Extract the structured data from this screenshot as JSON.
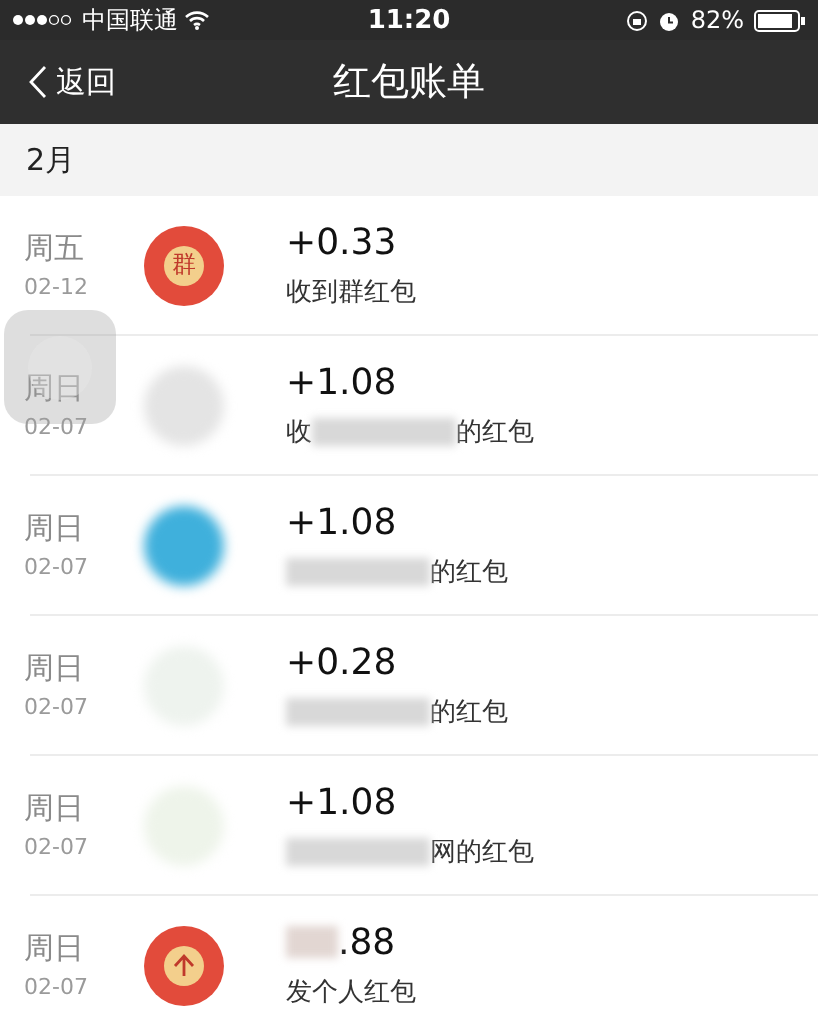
{
  "status_bar": {
    "carrier": "中国联通",
    "time": "11:20",
    "battery": "82%"
  },
  "nav": {
    "back": "返回",
    "title": "红包账单"
  },
  "section": "2月",
  "records": [
    {
      "weekday": "周五",
      "date": "02-12",
      "icon": {
        "kind": "group",
        "glyph": "群"
      },
      "amount": "+0.33",
      "amount_blurred": false,
      "description_blurred": false,
      "description": "收到群红包"
    },
    {
      "weekday": "周日",
      "date": "02-07",
      "icon": {
        "kind": "blurred",
        "color": "#e4e4e4"
      },
      "amount": "+1.08",
      "amount_blurred": false,
      "description_lead": "收",
      "description_blurred": true,
      "description": "的红包"
    },
    {
      "weekday": "周日",
      "date": "02-07",
      "icon": {
        "kind": "blurred",
        "color": "#3fb0dc"
      },
      "amount": "+1.08",
      "amount_blurred": false,
      "description_blurred": true,
      "description": "的红包"
    },
    {
      "weekday": "周日",
      "date": "02-07",
      "icon": {
        "kind": "blurred",
        "color": "#eef3ee"
      },
      "amount": "+0.28",
      "amount_blurred": false,
      "description_blurred": true,
      "description": "的红包"
    },
    {
      "weekday": "周日",
      "date": "02-07",
      "icon": {
        "kind": "blurred",
        "color": "#eef4ea"
      },
      "amount": "+1.08",
      "amount_blurred": false,
      "description_blurred": true,
      "description": "网的红包"
    },
    {
      "weekday": "周日",
      "date": "02-07",
      "icon": {
        "kind": "sent"
      },
      "amount": ".88",
      "amount_blurred": true,
      "description_blurred": false,
      "description": "发个人红包"
    }
  ],
  "assistive_touch": true
}
